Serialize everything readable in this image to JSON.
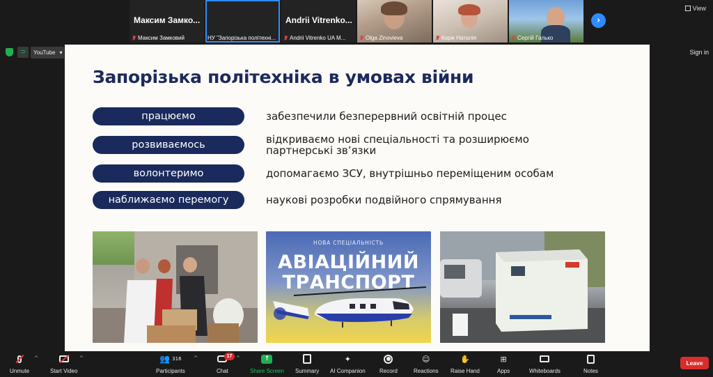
{
  "participants_strip": [
    {
      "big_name": "Максим  Замко...",
      "caption": "Максим Замковий",
      "muted": true
    },
    {
      "big_name": "",
      "caption": "НУ \"Запорізька політехні...",
      "muted": false
    },
    {
      "big_name": "Andrii  Vitrenko...",
      "caption": "Andrii Vitrenko UA M...",
      "muted": true
    },
    {
      "big_name": "",
      "caption": "Olga Zinovieva",
      "muted": true
    },
    {
      "big_name": "",
      "caption": "Корж Наталія",
      "muted": true
    },
    {
      "big_name": "",
      "caption": "Сергій Галько",
      "muted": true
    }
  ],
  "top_right": {
    "view_label": "View",
    "signin_label": "Sign in"
  },
  "browser_bar": {
    "youtube_label": "YouTube"
  },
  "slide": {
    "title": "Запорізька політехніка в умовах війни",
    "rows": [
      {
        "pill": "працюємо",
        "desc": "забезпечили безперервний освітній процес"
      },
      {
        "pill": "розвиваємось",
        "desc": "відкриваємо нові спеціальності та розширюємо партнерські зв’язки"
      },
      {
        "pill": "волонтеримо",
        "desc": "допомагаємо ЗСУ, внутрішньо переміщеним особам"
      },
      {
        "pill": "наближаємо перемогу",
        "desc": "наукові розробки подвійного спрямування"
      }
    ],
    "photo2": {
      "subtitle": "НОВА СПЕЦІАЛЬНІСТЬ",
      "title_line1": "АВІАЦІЙНИЙ",
      "title_line2": "ТРАНСПОРТ"
    }
  },
  "toolbar": {
    "unmute": "Unmute",
    "start_video": "Start Video",
    "participants": "Participants",
    "participants_count": "316",
    "chat": "Chat",
    "chat_badge": "17",
    "share_screen": "Share Screen",
    "summary": "Summary",
    "ai_companion": "AI Companion",
    "record": "Record",
    "reactions": "Reactions",
    "raise_hand": "Raise Hand",
    "apps": "Apps",
    "whiteboards": "Whiteboards",
    "notes": "Notes",
    "leave": "Leave"
  },
  "colors": {
    "accent": "#2d8cff",
    "slide_navy": "#1b2a5c",
    "leave_red": "#d92d2d",
    "share_green": "#20b050"
  }
}
